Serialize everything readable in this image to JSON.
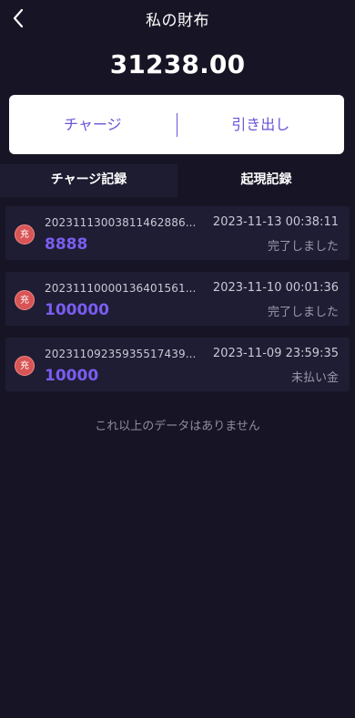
{
  "header": {
    "title": "私の財布",
    "back_icon": "chevron-left-icon"
  },
  "wallet": {
    "balance": "31238.00"
  },
  "actions": {
    "charge_label": "チャージ",
    "withdraw_label": "引き出し"
  },
  "tabs": [
    {
      "label": "チャージ記録",
      "active": true
    },
    {
      "label": "起現記録",
      "active": false
    }
  ],
  "records": [
    {
      "badge": "充",
      "order_id": "20231113003811462886...",
      "time": "2023-11-13 00:38:11",
      "amount": "8888",
      "status": "完了しました"
    },
    {
      "badge": "充",
      "order_id": "20231110000136401561...",
      "time": "2023-11-10 00:01:36",
      "amount": "100000",
      "status": "完了しました"
    },
    {
      "badge": "充",
      "order_id": "20231109235935517439...",
      "time": "2023-11-09 23:59:35",
      "amount": "10000",
      "status": "未払い金"
    }
  ],
  "footer": {
    "no_more_text": "これ以上のデータはありません"
  },
  "colors": {
    "background": "#171525",
    "accent": "#7a5df0",
    "badge": "#d95454"
  }
}
